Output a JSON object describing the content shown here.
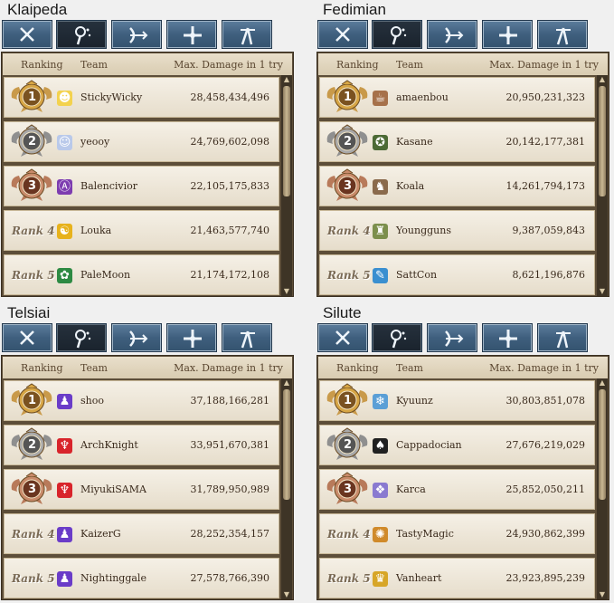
{
  "header": {
    "ranking": "Ranking",
    "team": "Team",
    "damage": "Max. Damage in 1 try"
  },
  "tabs": [
    "sword-icon",
    "staff-icon",
    "bow-icon",
    "cross-icon",
    "wand-icon"
  ],
  "panels": [
    {
      "region": "Klaipeda",
      "active_tab": 1,
      "rows": [
        {
          "rank": "1",
          "team": "StickyWicky",
          "damage": "28,458,434,496",
          "avatar": "sunglasses-avatar-icon",
          "avatar_color": "#f3d24e",
          "avatar_glyph": "☻"
        },
        {
          "rank": "2",
          "team": "yeooy",
          "damage": "24,769,602,098",
          "avatar": "girl-avatar-icon",
          "avatar_color": "#b9c9ea",
          "avatar_glyph": "☺"
        },
        {
          "rank": "3",
          "team": "Balencivior",
          "damage": "22,105,175,833",
          "avatar": "anarchy-symbol-icon",
          "avatar_color": "#7d3cb0",
          "avatar_glyph": "Ⓐ"
        },
        {
          "rank": "Rank 4",
          "team": "Louka",
          "damage": "21,463,577,740",
          "avatar": "yellow-dragon-icon",
          "avatar_color": "#e7b21c",
          "avatar_glyph": "☯"
        },
        {
          "rank": "Rank 5",
          "team": "PaleMoon",
          "damage": "21,174,172,108",
          "avatar": "green-leaf-icon",
          "avatar_color": "#2d8a43",
          "avatar_glyph": "✿"
        }
      ]
    },
    {
      "region": "Fedimian",
      "active_tab": 1,
      "rows": [
        {
          "rank": "1",
          "team": "amaenbou",
          "damage": "20,950,231,323",
          "avatar": "cup-icon",
          "avatar_color": "#a6714a",
          "avatar_glyph": "☕"
        },
        {
          "rank": "2",
          "team": "Kasane",
          "damage": "20,142,177,381",
          "avatar": "green-emblem-icon",
          "avatar_color": "#4c6a35",
          "avatar_glyph": "✪"
        },
        {
          "rank": "3",
          "team": "Koala",
          "damage": "14,261,794,173",
          "avatar": "koala-portrait-icon",
          "avatar_color": "#8a6a4c",
          "avatar_glyph": "♞"
        },
        {
          "rank": "Rank 4",
          "team": "Youngguns",
          "damage": "9,387,059,843",
          "avatar": "character-portrait-icon",
          "avatar_color": "#7c8f4c",
          "avatar_glyph": "♜"
        },
        {
          "rank": "Rank 5",
          "team": "SattCon",
          "damage": "8,621,196,876",
          "avatar": "feather-icon",
          "avatar_color": "#3a8fd0",
          "avatar_glyph": "✎"
        }
      ]
    },
    {
      "region": "Telsiai",
      "active_tab": 1,
      "rows": [
        {
          "rank": "1",
          "team": "shoo",
          "damage": "37,188,166,281",
          "avatar": "purple-figure-icon",
          "avatar_color": "#6a3cc8",
          "avatar_glyph": "♟"
        },
        {
          "rank": "2",
          "team": "ArchKnight",
          "damage": "33,951,670,381",
          "avatar": "red-wing-icon",
          "avatar_color": "#d8242b",
          "avatar_glyph": "♆"
        },
        {
          "rank": "3",
          "team": "MiyukiSAMA",
          "damage": "31,789,950,989",
          "avatar": "red-wing-icon",
          "avatar_color": "#d8242b",
          "avatar_glyph": "♆"
        },
        {
          "rank": "Rank 4",
          "team": "KaizerG",
          "damage": "28,252,354,157",
          "avatar": "purple-figure-icon",
          "avatar_color": "#6a3cc8",
          "avatar_glyph": "♟"
        },
        {
          "rank": "Rank 5",
          "team": "Nightinggale",
          "damage": "27,578,766,390",
          "avatar": "purple-figure-icon",
          "avatar_color": "#6a3cc8",
          "avatar_glyph": "♟"
        }
      ]
    },
    {
      "region": "Silute",
      "active_tab": 1,
      "rows": [
        {
          "rank": "1",
          "team": "Kyuunz",
          "damage": "30,803,851,078",
          "avatar": "snowflake-icon",
          "avatar_color": "#5b9fd6",
          "avatar_glyph": "❄"
        },
        {
          "rank": "2",
          "team": "Cappadocian",
          "damage": "27,676,219,029",
          "avatar": "hat-icon",
          "avatar_color": "#202020",
          "avatar_glyph": "♠"
        },
        {
          "rank": "3",
          "team": "Karca",
          "damage": "25,852,050,211",
          "avatar": "crest-icon",
          "avatar_color": "#8a7ad0",
          "avatar_glyph": "❖"
        },
        {
          "rank": "Rank 4",
          "team": "TastyMagic",
          "damage": "24,930,862,399",
          "avatar": "swirl-icon",
          "avatar_color": "#d08a2a",
          "avatar_glyph": "✺"
        },
        {
          "rank": "Rank 5",
          "team": "Vanheart",
          "damage": "23,923,895,239",
          "avatar": "gold-emblem-icon",
          "avatar_color": "#d7a628",
          "avatar_glyph": "♛"
        }
      ]
    }
  ]
}
